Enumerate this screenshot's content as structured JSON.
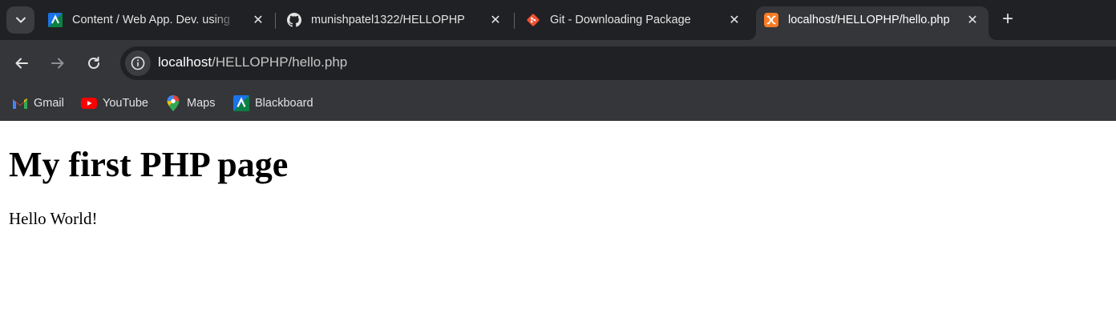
{
  "browser": {
    "tabs": [
      {
        "title": "Content / Web App. Dev. using",
        "icon": "blackboard-icon"
      },
      {
        "title": "munishpatel1322/HELLOPHP",
        "icon": "github-icon"
      },
      {
        "title": "Git - Downloading Package",
        "icon": "git-icon"
      },
      {
        "title": "localhost/HELLOPHP/hello.php",
        "icon": "xampp-icon",
        "active": true
      }
    ],
    "close_glyph": "✕",
    "new_tab_glyph": "+",
    "url_host": "localhost",
    "url_path": "/HELLOPHP/hello.php",
    "bookmarks": [
      {
        "label": "Gmail",
        "icon": "gmail-icon"
      },
      {
        "label": "YouTube",
        "icon": "youtube-icon"
      },
      {
        "label": "Maps",
        "icon": "maps-icon"
      },
      {
        "label": "Blackboard",
        "icon": "blackboard-icon"
      }
    ],
    "colors": {
      "tabstrip": "#202124",
      "toolbar": "#35363a",
      "omnibox": "#202124",
      "text": "#e3e3e3"
    }
  },
  "page": {
    "heading": "My first PHP page",
    "body_text": "Hello World!"
  }
}
